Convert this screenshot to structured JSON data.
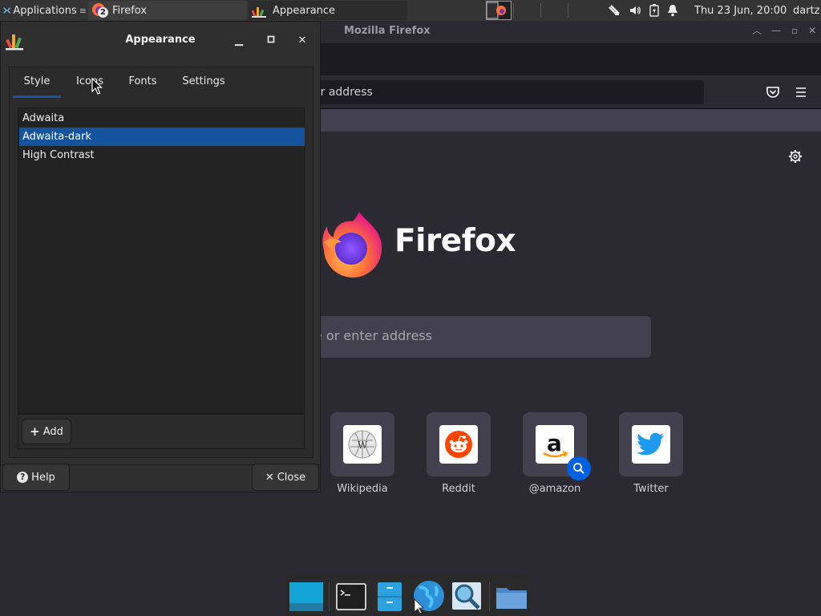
{
  "panel": {
    "apps_label": "Applications",
    "tasks": [
      {
        "label": "Firefox",
        "badge": "2"
      },
      {
        "label": "Appearance"
      }
    ],
    "clock": "Thu 23 Jun, 20:00",
    "user": "dartz"
  },
  "firefox": {
    "window_title": "Mozilla Firefox",
    "urlbar_text": "er address",
    "logo_wordmark": "Firefox",
    "search_placeholder": "e or enter address",
    "shortcuts": [
      {
        "label": "Wikipedia",
        "icon": "wikipedia-icon"
      },
      {
        "label": "Reddit",
        "icon": "reddit-icon"
      },
      {
        "label": "@amazon",
        "icon": "amazon-icon"
      },
      {
        "label": "Twitter",
        "icon": "twitter-icon"
      }
    ]
  },
  "dialog": {
    "title": "Appearance",
    "tabs": [
      "Style",
      "Icons",
      "Fonts",
      "Settings"
    ],
    "active_tab": "Style",
    "themes": [
      "Adwaita",
      "Adwaita-dark",
      "High Contrast"
    ],
    "selected_theme": "Adwaita-dark",
    "add_label": "Add",
    "help_label": "Help",
    "close_label": "Close"
  },
  "colors": {
    "accent": "#15539e",
    "firefox_bg": "#2b2a33",
    "sponsor_blue": "#0060df"
  }
}
